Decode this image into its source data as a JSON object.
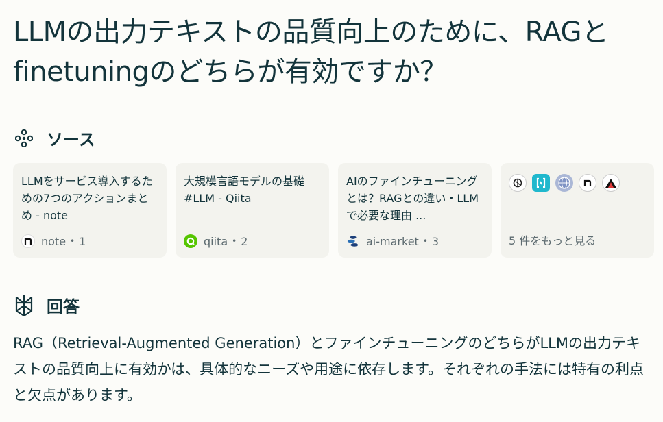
{
  "question": "LLMの出力テキストの品質向上のために、RAGとfinetuningのどちらが有効ですか？",
  "sources": {
    "heading": "ソース",
    "icon": "sources-dots-icon",
    "cards": [
      {
        "title": "LLMをサービス導入するための7つのアクションまとめ - note",
        "site": "note",
        "index": "1",
        "favicon": "note-icon"
      },
      {
        "title": "大規模言語モデルの基礎 #LLM - Qiita",
        "site": "qiita",
        "index": "2",
        "favicon": "qiita-icon"
      },
      {
        "title": "AIのファインチューニングとは？RAGとの違い・LLMで必要な理由 ...",
        "site": "ai-market",
        "index": "3",
        "favicon": "ai-market-icon"
      }
    ],
    "more": {
      "label": "5 件をもっと見る",
      "icons": [
        "openai-icon",
        "bracket-logo-icon",
        "globe-icon",
        "note-icon",
        "mountain-logo-icon"
      ]
    }
  },
  "answer": {
    "heading": "回答",
    "icon": "perplexity-logo-icon",
    "text": "RAG（Retrieval-Augmented Generation）とファインチューニングのどちらがLLMの出力テキストの品質向上に有効かは、具体的なニーズや用途に依存します。それぞれの手法には特有の利点と欠点があります。"
  },
  "colors": {
    "background": "#fcfcf9",
    "card": "#f3f3ee",
    "text": "#13343b",
    "muted": "#5d6b70",
    "accent_teal": "#20b8cd"
  }
}
